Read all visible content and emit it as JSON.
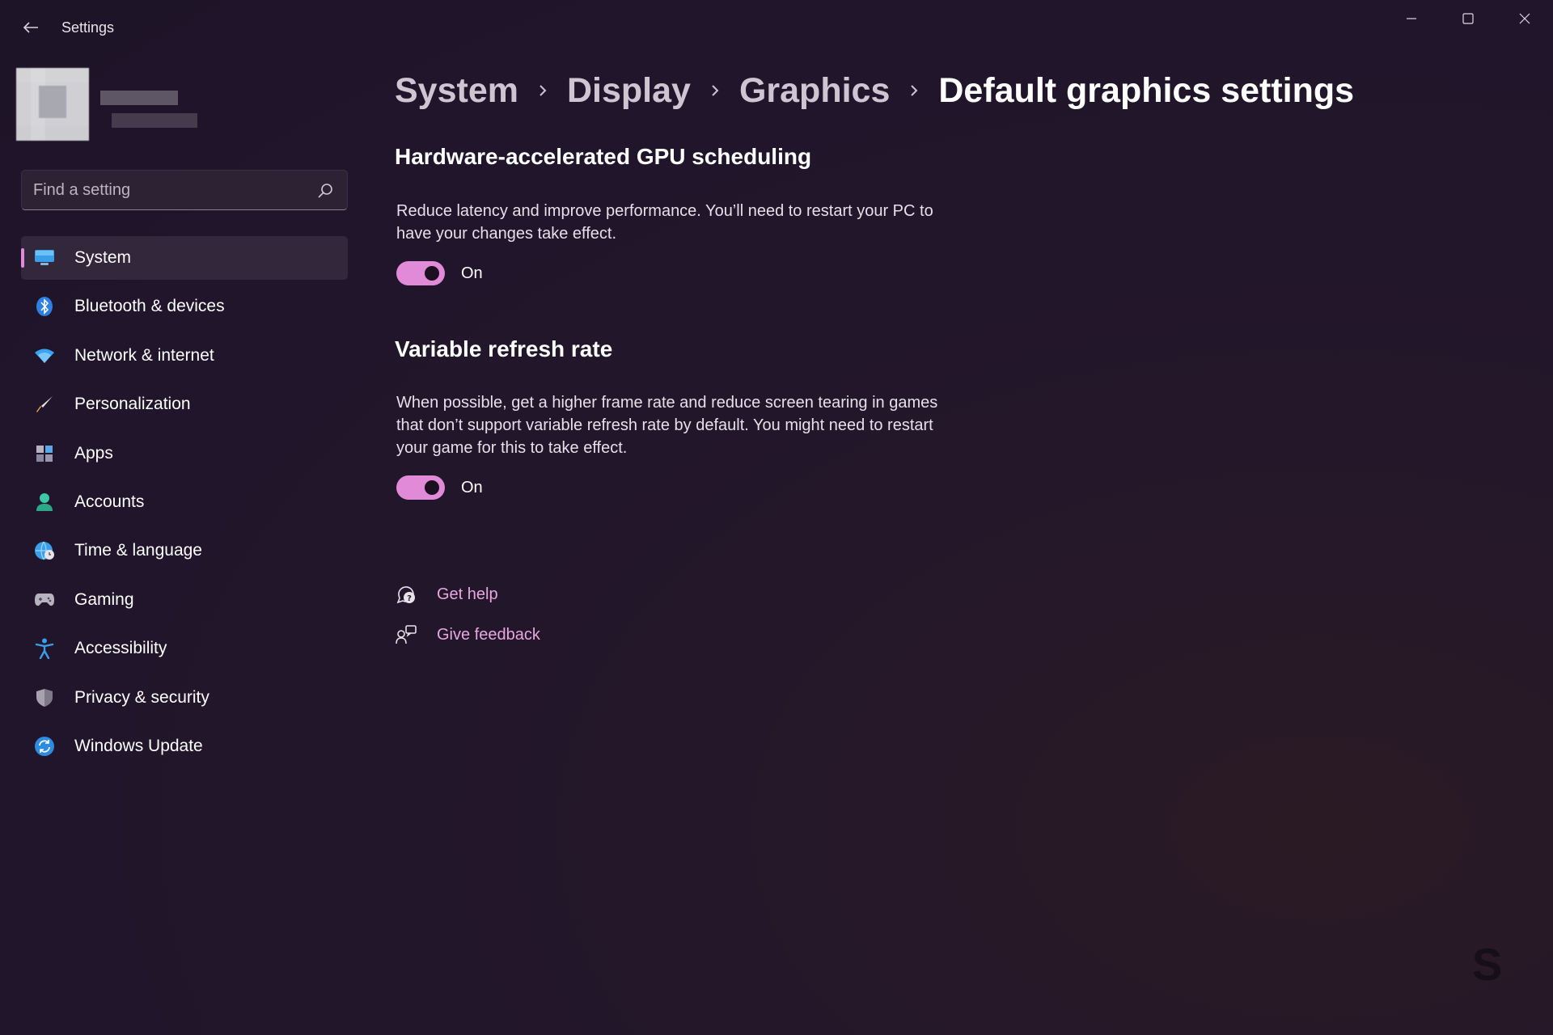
{
  "window": {
    "title": "Settings",
    "controls": [
      "minimize",
      "maximize",
      "close"
    ]
  },
  "profile": {
    "name": "",
    "email": ""
  },
  "search": {
    "placeholder": "Find a setting",
    "value": ""
  },
  "sidebar": {
    "items": [
      {
        "label": "System",
        "icon": "monitor-icon",
        "active": true
      },
      {
        "label": "Bluetooth & devices",
        "icon": "bluetooth-icon"
      },
      {
        "label": "Network & internet",
        "icon": "wifi-icon"
      },
      {
        "label": "Personalization",
        "icon": "brush-icon"
      },
      {
        "label": "Apps",
        "icon": "apps-icon"
      },
      {
        "label": "Accounts",
        "icon": "person-icon"
      },
      {
        "label": "Time & language",
        "icon": "globe-clock-icon"
      },
      {
        "label": "Gaming",
        "icon": "controller-icon"
      },
      {
        "label": "Accessibility",
        "icon": "accessibility-icon"
      },
      {
        "label": "Privacy & security",
        "icon": "shield-icon"
      },
      {
        "label": "Windows Update",
        "icon": "update-icon"
      }
    ]
  },
  "breadcrumb": {
    "items": [
      "System",
      "Display",
      "Graphics",
      "Default graphics settings"
    ]
  },
  "sections": {
    "gpu": {
      "title": "Hardware-accelerated GPU scheduling",
      "description": "Reduce latency and improve performance. You’ll need to restart your PC to have your changes take effect.",
      "toggle_label": "On",
      "enabled": true
    },
    "vrr": {
      "title": "Variable refresh rate",
      "description": "When possible, get a higher frame rate and reduce screen tearing in games that don’t support variable refresh rate by default. You might need to restart your game for this to take effect.",
      "toggle_label": "On",
      "enabled": true
    }
  },
  "links": {
    "help": "Get help",
    "feedback": "Give feedback"
  },
  "watermark": "S",
  "colors": {
    "accent": "#e08ad8",
    "link": "#e7a8e0",
    "background": "#21162a"
  }
}
